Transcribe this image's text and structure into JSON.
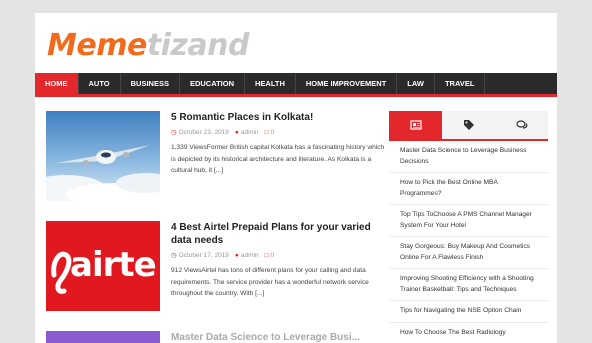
{
  "logo": {
    "part1": "Meme",
    "part2": "tizand"
  },
  "nav": [
    "HOME",
    "AUTO",
    "BUSINESS",
    "EDUCATION",
    "HEALTH",
    "HOME IMPROVEMENT",
    "LAW",
    "TRAVEL"
  ],
  "posts": [
    {
      "title": "5 Romantic Places in Kolkata!",
      "date": "October 23, 2019",
      "author": "admin",
      "comments": "0",
      "excerpt": "1,339 ViewsFormer British capital Kolkata has a fascinating history which is depicted by its historical architecture and literature. As Kolkata is a cultural hub, it [...]"
    },
    {
      "title": "4 Best Airtel Prepaid Plans for your varied data needs",
      "date": "October 17, 2019",
      "author": "admin",
      "comments": "0",
      "excerpt": "912 ViewsAirtel has tons of different plans for your calling and data requirements. The service provider has a wonderful network service throughout the country. With [...]",
      "thumb_text": "airte"
    },
    {
      "title": "Master Data Science to Leverage Busi..."
    }
  ],
  "sidebar": {
    "tabs": [
      {
        "icon": "newspaper-icon"
      },
      {
        "icon": "tags-icon"
      },
      {
        "icon": "comments-icon"
      }
    ],
    "items": [
      "Master Data Science to Leverage Business Decisions",
      "How to Pick the Best Online MBA Programmes?",
      "Top Tips ToChoose A PMS Channel Manager System For Your Hotel",
      "Stay Gorgeous: Buy Makeup And Cosmetics Online For A Flawless Finish",
      "Improving Shooting Efficiency with a Shooting Trainer Basketball: Tips and Techniques",
      "Tips for Navigating the NSE Option Chain",
      "How To Choose The Best Radiology"
    ]
  },
  "colors": {
    "accent": "#e2282c",
    "logo_orange": "#f26b1d",
    "nav_bg": "#2a2a2a"
  }
}
